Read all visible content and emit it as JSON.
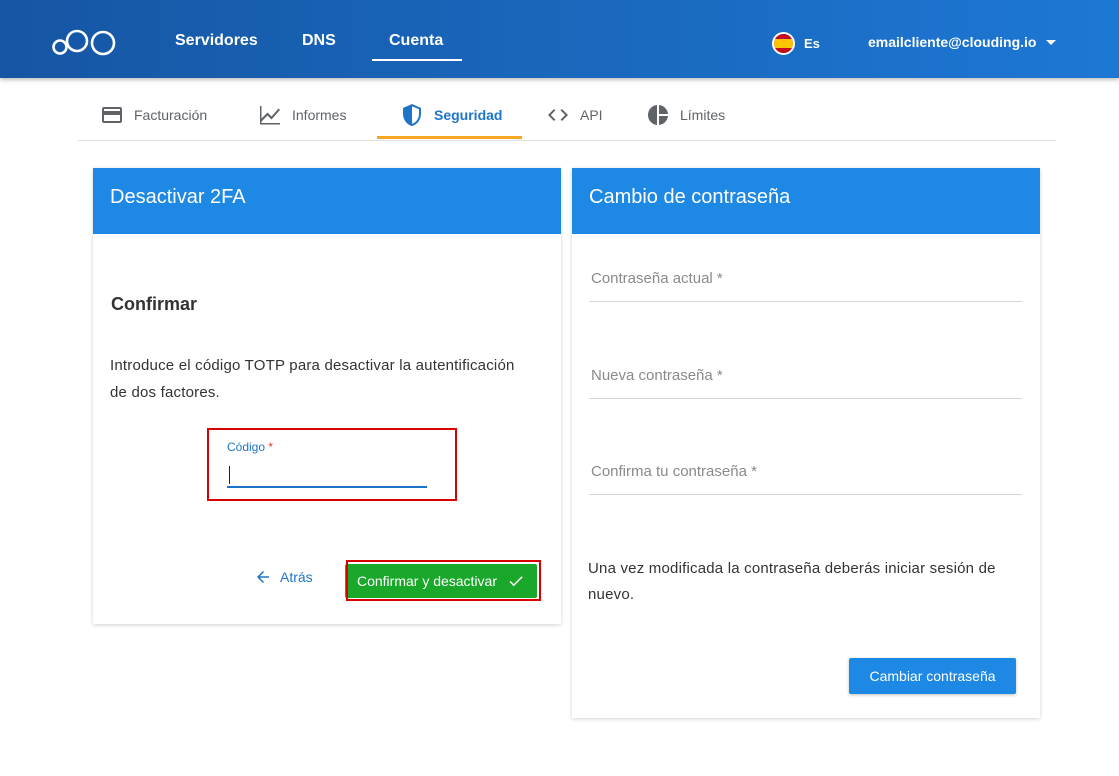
{
  "header": {
    "nav": [
      {
        "label": "Servidores"
      },
      {
        "label": "DNS"
      },
      {
        "label": "Cuenta"
      }
    ],
    "language": "Es",
    "account_email": "emailcliente@clouding.io"
  },
  "tabs": [
    {
      "label": "Facturación",
      "icon": "credit-card-icon"
    },
    {
      "label": "Informes",
      "icon": "chart-line-icon"
    },
    {
      "label": "Seguridad",
      "icon": "shield-icon",
      "active": true
    },
    {
      "label": "API",
      "icon": "code-icon"
    },
    {
      "label": "Límites",
      "icon": "pie-chart-icon"
    }
  ],
  "disable_2fa": {
    "title": "Desactivar 2FA",
    "subtitle": "Confirmar",
    "description": "Introduce el código TOTP para desactivar la autentificación de dos factores.",
    "code_label": "Código",
    "required_mark": "*",
    "code_value": "",
    "back_label": "Atrás",
    "confirm_label": "Confirmar y desactivar"
  },
  "password_change": {
    "title": "Cambio de contraseña",
    "current_label": "Contraseña actual *",
    "new_label": "Nueva contraseña *",
    "confirm_label": "Confirma tu contraseña *",
    "note": "Una vez modificada la contraseña deberás iniciar sesión de nuevo.",
    "button_label": "Cambiar contraseña"
  },
  "colors": {
    "header_start": "#1656a4",
    "header_end": "#1d78d4",
    "card_header": "#1e88e5",
    "confirm_button": "#19a82a",
    "tab_indicator": "#f5a623",
    "highlight": "#d90000"
  }
}
